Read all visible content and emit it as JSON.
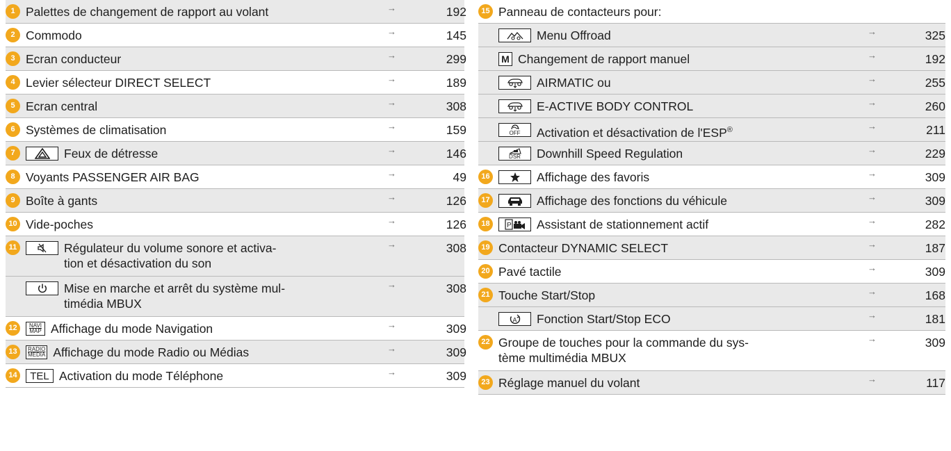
{
  "left_column": [
    {
      "badge": "1",
      "label": "Palettes de changement de rapport au volant",
      "page": "192"
    },
    {
      "badge": "2",
      "label": "Commodo",
      "page": "145"
    },
    {
      "badge": "3",
      "label": "Ecran conducteur",
      "page": "299"
    },
    {
      "badge": "4",
      "label": "Levier sélecteur DIRECT SELECT",
      "page": "189"
    },
    {
      "badge": "5",
      "label": "Ecran central",
      "page": "308"
    },
    {
      "badge": "6",
      "label": "Systèmes de climatisation",
      "page": "159"
    },
    {
      "badge": "7",
      "label": "Feux de détresse",
      "page": "146",
      "icon": "hazard-warning-icon"
    },
    {
      "badge": "8",
      "label": "Voyants PASSENGER AIR BAG",
      "page": "49"
    },
    {
      "badge": "9",
      "label": "Boîte à gants",
      "page": "126"
    },
    {
      "badge": "10",
      "label": "Vide-poches",
      "page": "126"
    },
    {
      "badge": "11",
      "label_line1": "Régulateur du volume sonore et activa-",
      "label_line2": "tion et désactivation du son",
      "page": "308",
      "icon": "mute-speaker-icon"
    },
    {
      "badge": "",
      "label_line1": "Mise en marche et arrêt du système mul-",
      "label_line2": "timédia MBUX",
      "page": "308",
      "icon": "power-icon"
    },
    {
      "badge": "12",
      "label": "Affichage du mode Navigation",
      "page": "309",
      "key_top": "NAVI",
      "key_bottom": "MAP"
    },
    {
      "badge": "13",
      "label": "Affichage du mode Radio ou Médias",
      "page": "309",
      "key_top": "RADIO",
      "key_bottom": "MEDIA"
    },
    {
      "badge": "14",
      "label": "Activation du mode Téléphone",
      "page": "309",
      "key_text": "TEL"
    }
  ],
  "right_column": [
    {
      "badge": "15",
      "label": "Panneau de contacteurs pour:"
    },
    {
      "label": "Menu Offroad",
      "page": "325",
      "icon": "offroad-icon"
    },
    {
      "label": "Changement de rapport manuel",
      "page": "192",
      "key_text": "M"
    },
    {
      "label": "AIRMATIC ou",
      "page": "255",
      "icon": "suspension-level-icon"
    },
    {
      "label": "E-ACTIVE BODY CONTROL",
      "page": "260",
      "icon": "suspension-level-icon"
    },
    {
      "label": "Activation et désactivation de l'ESP",
      "label_sup": "®",
      "page": "211",
      "icon": "esp-off-icon",
      "icon_text": "OFF"
    },
    {
      "label": "Downhill Speed Regulation",
      "page": "229",
      "icon": "dsr-icon",
      "icon_text": "DSR"
    },
    {
      "badge": "16",
      "label": "Affichage des favoris",
      "page": "309",
      "icon": "star-icon"
    },
    {
      "badge": "17",
      "label": "Affichage des fonctions du véhicule",
      "page": "309",
      "icon": "car-icon"
    },
    {
      "badge": "18",
      "label": "Assistant de stationnement actif",
      "page": "282",
      "icon": "parking-camera-icon"
    },
    {
      "badge": "19",
      "label": "Contacteur DYNAMIC SELECT",
      "page": "187"
    },
    {
      "badge": "20",
      "label": "Pavé tactile",
      "page": "309"
    },
    {
      "badge": "21",
      "label": "Touche Start/Stop",
      "page": "168"
    },
    {
      "label": "Fonction Start/Stop ECO",
      "page": "181",
      "icon": "start-stop-eco-icon"
    },
    {
      "badge": "22",
      "label_line1": "Groupe de touches pour la commande du sys-",
      "label_line2": "tème multimédia MBUX",
      "page": "309"
    },
    {
      "badge": "23",
      "label": "Réglage manuel du volant",
      "page": "117"
    }
  ],
  "arrow_glyph": "→",
  "colors": {
    "badge": "#f2a81d",
    "shaded_row": "#e9e9e9",
    "divider": "#b9b9b9"
  }
}
